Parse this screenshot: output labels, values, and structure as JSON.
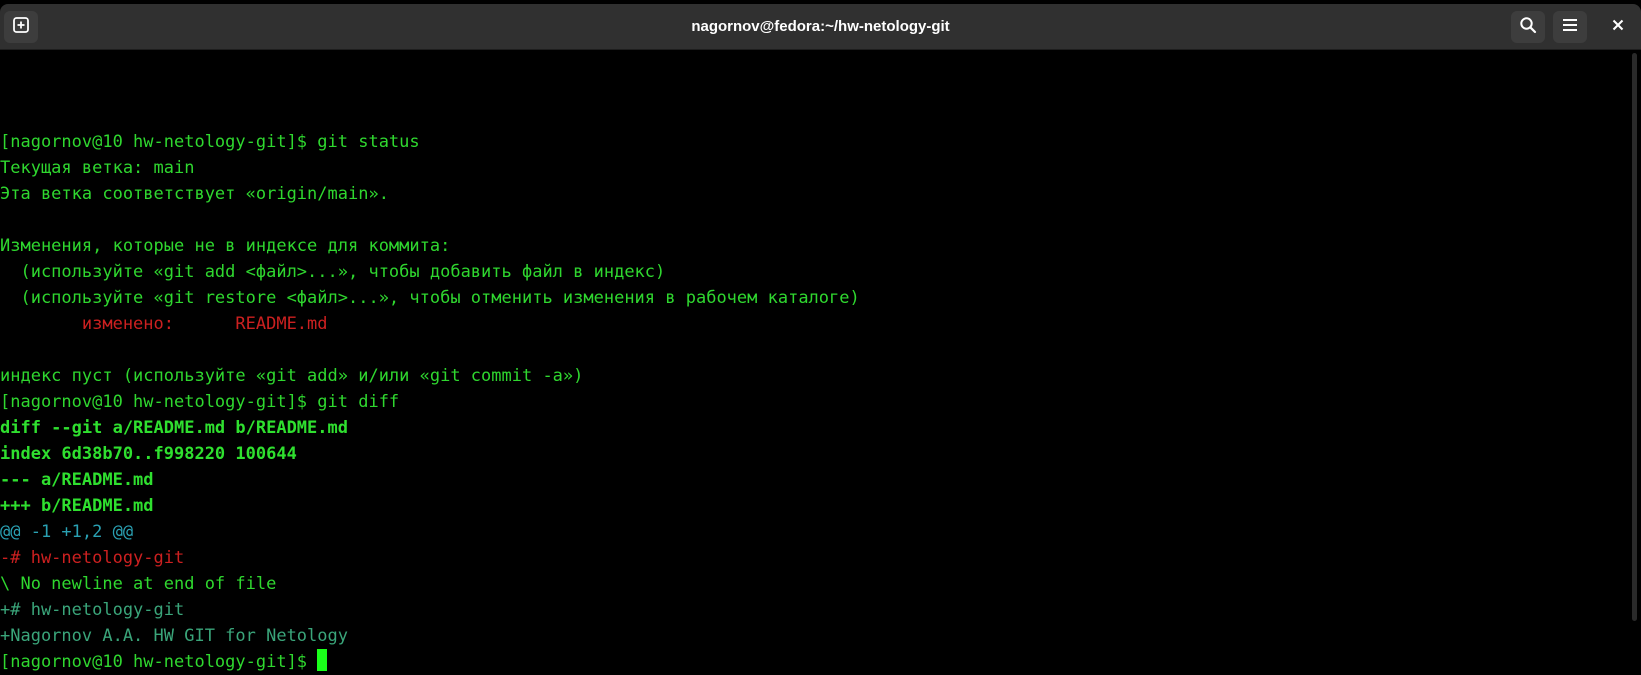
{
  "window": {
    "title": "nagornov@fedora:~/hw-netology-git",
    "behind_text": "..."
  },
  "toolbar": {
    "new_tab_icon": "new-tab-icon",
    "search_icon": "search-icon",
    "menu_icon": "hamburger-menu-icon",
    "close_label": "✕"
  },
  "terminal": {
    "lines": [
      {
        "text": "[nagornov@10 hw-netology-git]$ git status",
        "style": "green"
      },
      {
        "text": "Текущая ветка: main",
        "style": "green"
      },
      {
        "text": "Эта ветка соответствует «origin/main».",
        "style": "green"
      },
      {
        "text": "",
        "style": "green"
      },
      {
        "text": "Изменения, которые не в индексе для коммита:",
        "style": "green"
      },
      {
        "text": "  (используйте «git add <файл>...», чтобы добавить файл в индекс)",
        "style": "green"
      },
      {
        "text": "  (используйте «git restore <файл>...», чтобы отменить изменения в рабочем каталоге)",
        "style": "green"
      },
      {
        "text": "        изменено:      README.md",
        "style": "red"
      },
      {
        "text": "",
        "style": "green"
      },
      {
        "text": "индекс пуст (используйте «git add» и/или «git commit -a»)",
        "style": "green"
      },
      {
        "text": "[nagornov@10 hw-netology-git]$ git diff",
        "style": "green"
      },
      {
        "text": "diff --git a/README.md b/README.md",
        "style": "bold"
      },
      {
        "text": "index 6d38b70..f998220 100644",
        "style": "bold"
      },
      {
        "text": "--- a/README.md",
        "style": "bold"
      },
      {
        "text": "+++ b/README.md",
        "style": "bold"
      },
      {
        "text": "@@ -1 +1,2 @@",
        "style": "cyan"
      },
      {
        "text": "-# hw-netology-git",
        "style": "red"
      },
      {
        "text": "\\ No newline at end of file",
        "style": "green"
      },
      {
        "text": "+# hw-netology-git",
        "style": "dim-green"
      },
      {
        "text": "+Nagornov A.A. HW GIT for Netology",
        "style": "dim-green"
      }
    ],
    "prompt": "[nagornov@10 hw-netology-git]$ "
  },
  "colors": {
    "background": "#000000",
    "titlebar": "#303030",
    "text_green": "#2fd72f",
    "text_red": "#cc2020",
    "text_cyan": "#2aa1b3",
    "cursor": "#1aff1a"
  }
}
